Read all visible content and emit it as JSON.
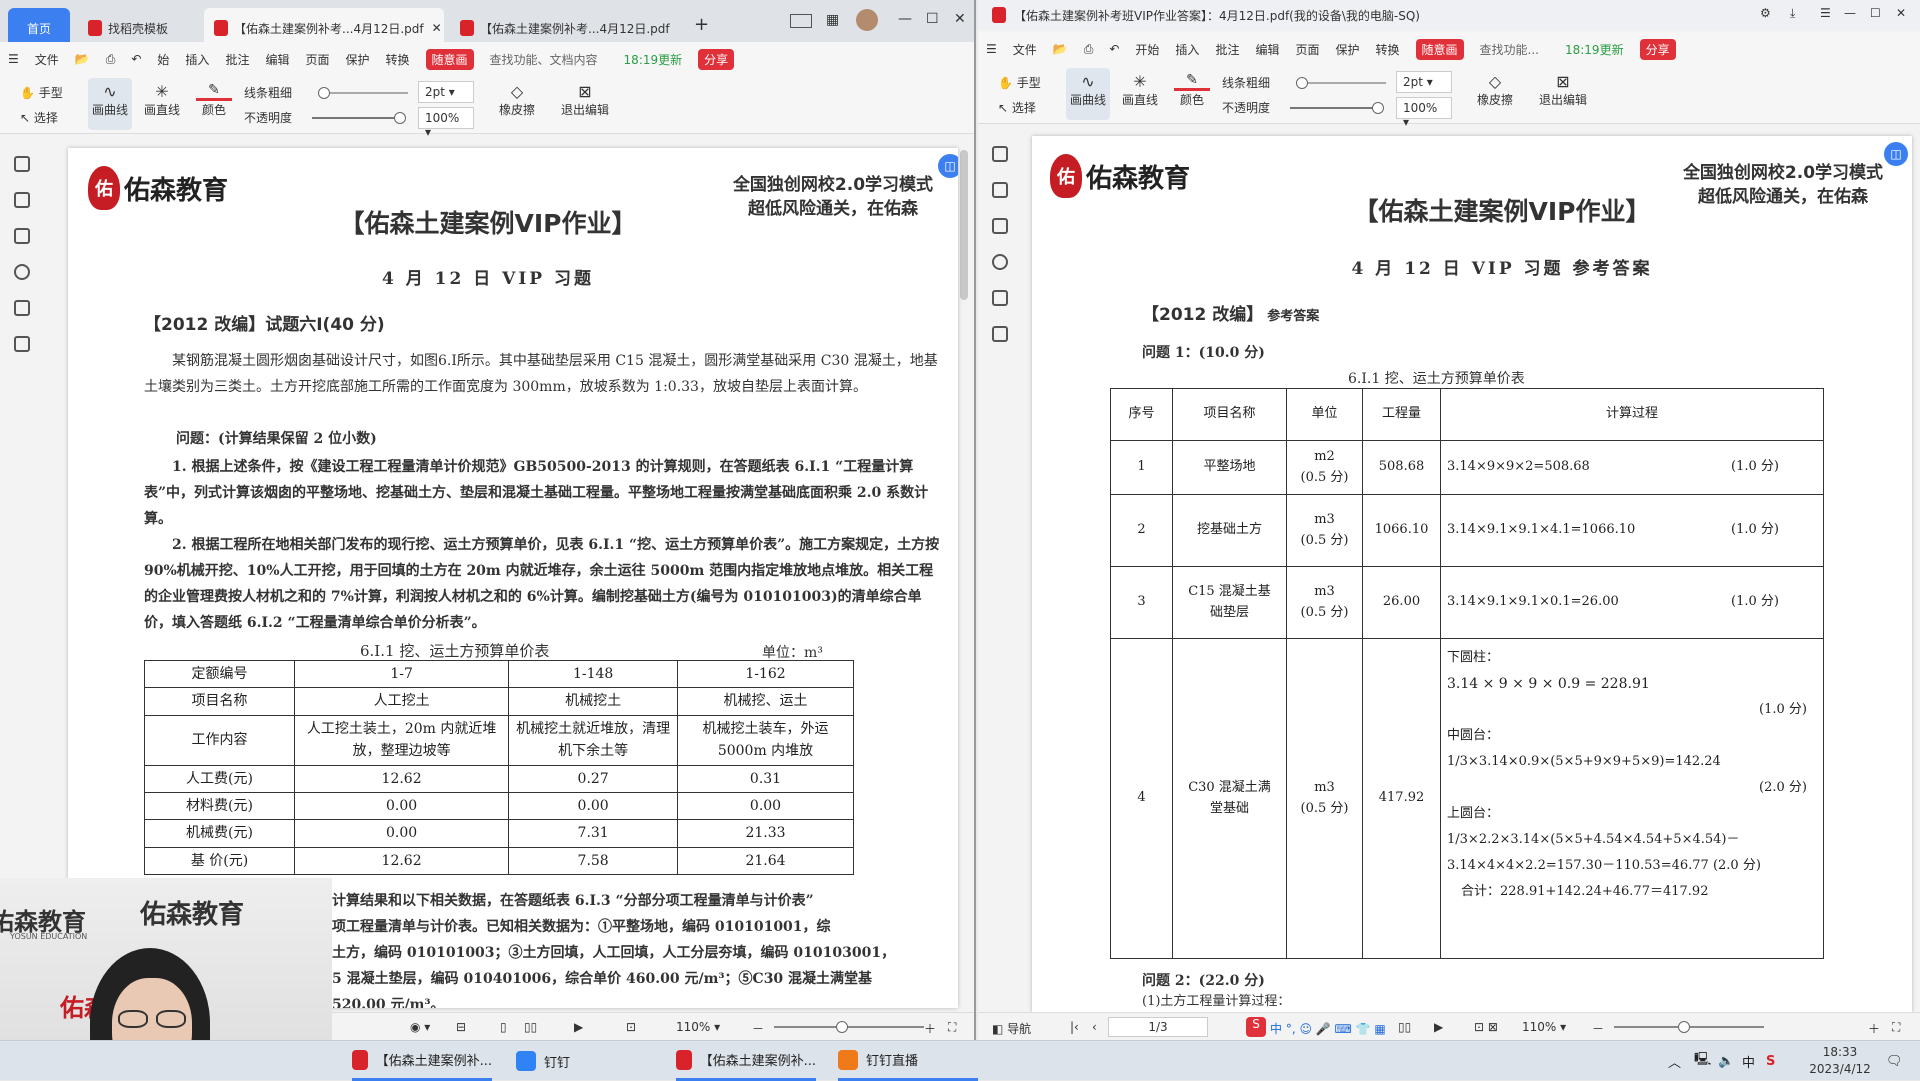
{
  "left": {
    "tabs": [
      "首页",
      "找稻壳模板",
      "【佑森土建案例补考...4月12日.pdf",
      "【佑森土建案例补考...4月12日.pdf"
    ],
    "menu": [
      "文件",
      "始",
      "插入",
      "批注",
      "编辑",
      "页面",
      "保护",
      "转换",
      "随意画",
      "查找功能、文档内容",
      "18:19更新",
      "分享"
    ],
    "tools": {
      "hand": "手型",
      "select": "选择",
      "draw_curve": "画曲线",
      "draw_line": "画直线",
      "color": "颜色",
      "line_width": "线条粗细",
      "opacity": "不透明度",
      "width_value": "2pt",
      "opacity_value": "100%",
      "eraser": "橡皮擦",
      "exit": "退出编辑"
    },
    "doc": {
      "slogan1": "全国独创网校2.0学习模式",
      "slogan2": "超低风险通关，在佑森",
      "logo": "佑森教育",
      "title": "【佑森土建案例VIP作业】",
      "subtitle": "4 月 12 日 VIP 习题",
      "question": "【2012 改编】试题六Ⅰ(40 分)",
      "p1": "某钢筋混凝土圆形烟囱基础设计尺寸，如图6.Ⅰ所示。其中基础垫层采用 C15 混凝土，圆形满堂基础采用 C30 混凝土，地基土壤类别为三类土。土方开挖底部施工所需的工作面宽度为 300mm，放坡系数为 1:0.33，放坡自垫层上表面计算。",
      "p2": "问题：(计算结果保留 2 位小数)",
      "p3": "1. 根据上述条件，按《建设工程工程量清单计价规范》GB50500-2013 的计算规则，在答题纸表 6.Ⅰ.1 “工程量计算表”中，列式计算该烟囱的平整场地、挖基础土方、垫层和混凝土基础工程量。平整场地工程量按满堂基础底面积乘 2.0 系数计算。",
      "p4": "2. 根据工程所在地相关部门发布的现行挖、运土方预算单价，见表 6.Ⅰ.1 “挖、运土方预算单价表”。施工方案规定，土方按 90%机械开挖、10%人工开挖，用于回填的土方在 20m 内就近堆存，余土运往 5000m 范围内指定堆放地点堆放。相关工程的企业管理费按人材机之和的 7%计算，利润按人材机之和的 6%计算。编制挖基础土方(编号为 010101003)的清单综合单价，填入答题纸 6.Ⅰ.2 “工程量清单综合单价分析表”。",
      "table_caption": "6.Ⅰ.1   挖、运土方预算单价表",
      "table_unit": "单位：m³",
      "table_rows": [
        [
          "定额编号",
          "1-7",
          "1-148",
          "1-162"
        ],
        [
          "项目名称",
          "人工挖土",
          "机械挖土",
          "机械挖、运土"
        ],
        [
          "工作内容",
          "人工挖土装土，20m 内就近堆放，整理边坡等",
          "机械挖土就近堆放，清理机下余土等",
          "机械挖土装车，外运 5000m 内堆放"
        ],
        [
          "人工费(元)",
          "12.62",
          "0.27",
          "0.31"
        ],
        [
          "材料费(元)",
          "0.00",
          "0.00",
          "0.00"
        ],
        [
          "机械费(元)",
          "0.00",
          "7.31",
          "21.33"
        ],
        [
          "基 价(元)",
          "12.62",
          "7.58",
          "21.64"
        ]
      ],
      "p5_lines": [
        "计算结果和以下相关数据，在答题纸表 6.Ⅰ.3 “分部分项工程量清单与计价表”",
        "项工程量清单与计价表。已知相关数据为：①平整场地，编码 010101001，综",
        "土方，编码 010101003；③土方回填，人工回填，人工分层夯填，编码 010103001，",
        "5 混凝土垫层，编码 010401006，综合单价 460.00 元/m³；⑤C30 混凝土满堂基",
        "520.00 元/m³。"
      ]
    },
    "status": {
      "zoom": "110%"
    }
  },
  "right": {
    "title": "【佑森土建案例补考班VIP作业答案】：4月12日.pdf(我的设备\\我的电脑-SQ)",
    "menu": [
      "文件",
      "开始",
      "插入",
      "批注",
      "编辑",
      "页面",
      "保护",
      "转换",
      "随意画",
      "查找功能...",
      "18:19更新",
      "分享"
    ],
    "tools": {
      "hand": "手型",
      "select": "选择",
      "draw_curve": "画曲线",
      "draw_line": "画直线",
      "color": "颜色",
      "line_width": "线条粗细",
      "opacity": "不透明度",
      "width_value": "2pt",
      "opacity_value": "100%",
      "eraser": "橡皮擦",
      "exit": "退出编辑"
    },
    "doc": {
      "slogan1": "全国独创网校2.0学习模式",
      "slogan2": "超低风险通关，在佑森",
      "logo": "佑森教育",
      "title": "【佑森土建案例VIP作业】",
      "subtitle": "4 月 12 日 VIP 习题 参考答案",
      "question": "【2012 改编】",
      "question_note": "参考答案",
      "q1": "问题 1：(10.0 分)",
      "table_caption": "6.Ⅰ.1   挖、运土方预算单价表",
      "headers": [
        "序号",
        "项目名称",
        "单位",
        "工程量",
        "计算过程"
      ],
      "rows": [
        {
          "no": "1",
          "name": "平整场地",
          "unit": "m2",
          "unit_score": "(0.5 分)",
          "qty": "508.68",
          "calc": "3.14×9×9×2=508.68",
          "score": "(1.0 分)"
        },
        {
          "no": "2",
          "name": "挖基础土方",
          "unit": "m3",
          "unit_score": "(0.5 分)",
          "qty": "1066.10",
          "calc": "3.14×9.1×9.1×4.1=1066.10",
          "score": "(1.0 分)"
        },
        {
          "no": "3",
          "name": "C15 混凝土基础垫层",
          "unit": "m3",
          "unit_score": "(0.5 分)",
          "qty": "26.00",
          "calc": "3.14×9.1×9.1×0.1=26.00",
          "score": "(1.0 分)"
        },
        {
          "no": "4",
          "name": "C30 混凝土满堂基础",
          "unit": "m3",
          "unit_score": "(0.5 分)",
          "qty": "417.92"
        }
      ],
      "row4_calc": {
        "lower": "下圆柱：",
        "lower_calc": "3.14  ×  9  ×  9  ×  0.9  =  228.91",
        "lower_score": "(1.0 分)",
        "mid": "中圆台：",
        "mid_calc": "1/3×3.14×0.9×(5×5+9×9+5×9)=142.24",
        "mid_score": "(2.0 分)",
        "upper": "上圆台：",
        "upper_calc1": "1/3×2.2×3.14×(5×5+4.54×4.54+5×4.54)－",
        "upper_calc2": "3.14×4×4×2.2=157.30－110.53=46.77   (2.0 分)",
        "total": "合计：228.91+142.24+46.77＝417.92"
      },
      "q2": "问题 2：(22.0 分)",
      "q2_sub": "(1)土方工程量计算过程："
    },
    "status": {
      "nav": "导航",
      "page": "1/3",
      "zoom": "110%"
    }
  },
  "taskbar": {
    "items": [
      "【佑森土建案例补...",
      "钉钉",
      "【佑森土建案例补...",
      "钉钉直播"
    ],
    "time": "18:33",
    "date": "2023/4/12",
    "ime": "中"
  },
  "webcam": {
    "brand": "佑森教育",
    "brand_en": "YOSUN EDUCATION"
  }
}
